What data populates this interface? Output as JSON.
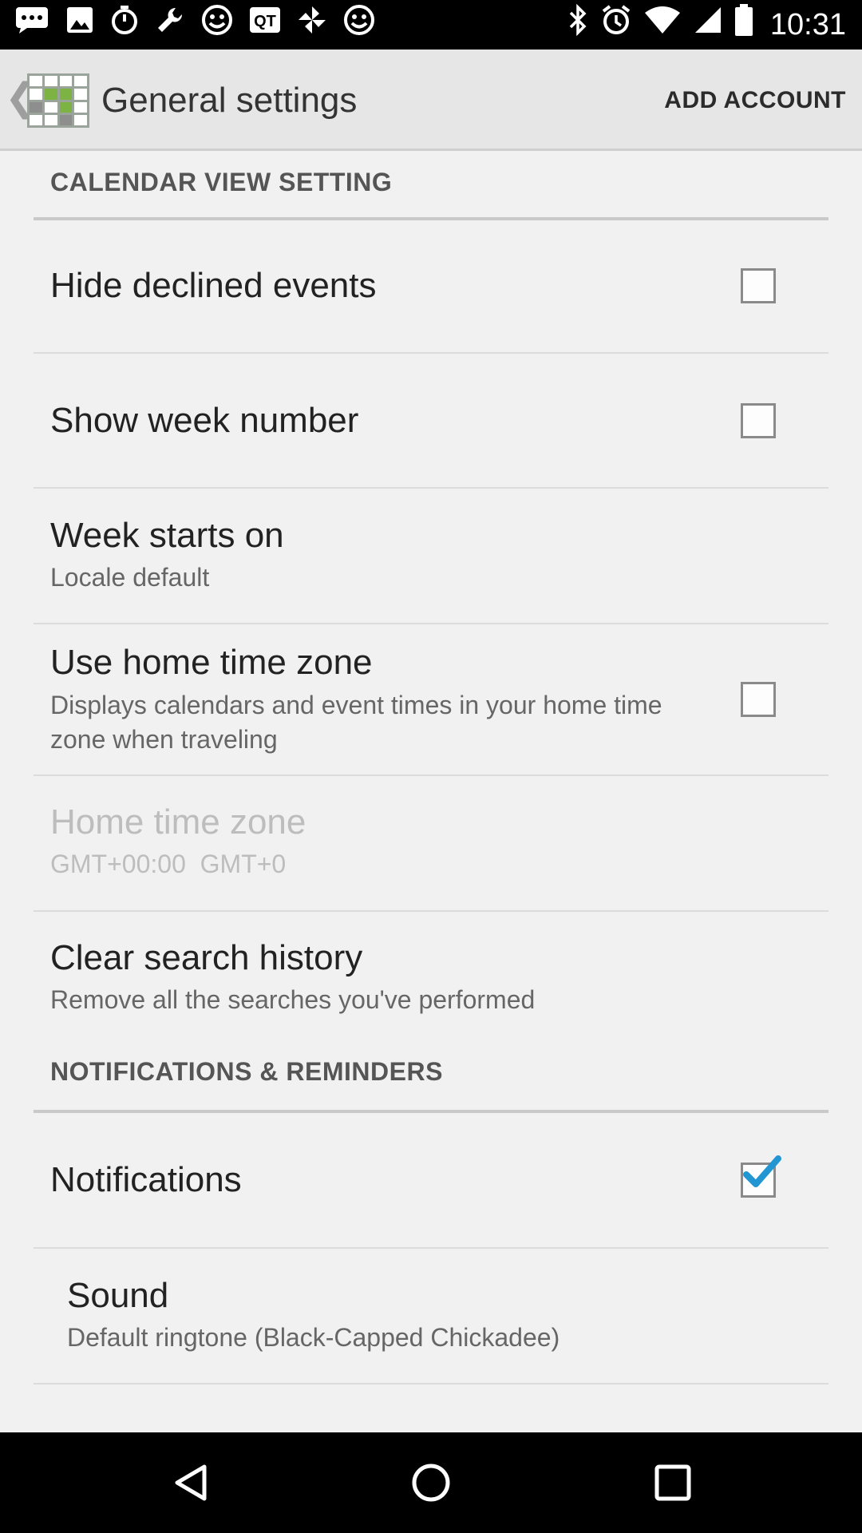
{
  "status_bar": {
    "time": "10:31",
    "left_icons": [
      "message-icon",
      "image-icon",
      "timer-icon",
      "wrench-icon",
      "smiley-icon",
      "qt-app-icon",
      "pinwheel-icon",
      "smiley-icon"
    ],
    "right_icons": [
      "bluetooth-icon",
      "alarm-icon",
      "wifi-icon",
      "cellular-signal-icon",
      "battery-icon"
    ]
  },
  "action_bar": {
    "title": "General settings",
    "add_account": "ADD ACCOUNT"
  },
  "sections": {
    "calendar_view": "CALENDAR VIEW SETTING",
    "notifications": "NOTIFICATIONS & REMINDERS"
  },
  "settings": {
    "hide_declined": {
      "title": "Hide declined events",
      "checked": false
    },
    "show_week_number": {
      "title": "Show week number",
      "checked": false
    },
    "week_starts_on": {
      "title": "Week starts on",
      "summary": "Locale default"
    },
    "use_home_tz": {
      "title": "Use home time zone",
      "summary": "Displays calendars and event times in your home time zone when traveling",
      "checked": false
    },
    "home_tz": {
      "title": "Home time zone",
      "summary": "GMT+00:00  GMT+0",
      "enabled": false
    },
    "clear_search": {
      "title": "Clear search history",
      "summary": "Remove all the searches you've performed"
    },
    "notifications": {
      "title": "Notifications",
      "checked": true
    },
    "sound": {
      "title": "Sound",
      "summary": "Default ringtone (Black-Capped Chickadee)"
    }
  },
  "colors": {
    "accent_check": "#2196d3",
    "background": "#f1f1f1",
    "action_bar": "#e6e6e6"
  },
  "nav_bar": [
    "back-icon",
    "home-icon",
    "recents-icon"
  ]
}
